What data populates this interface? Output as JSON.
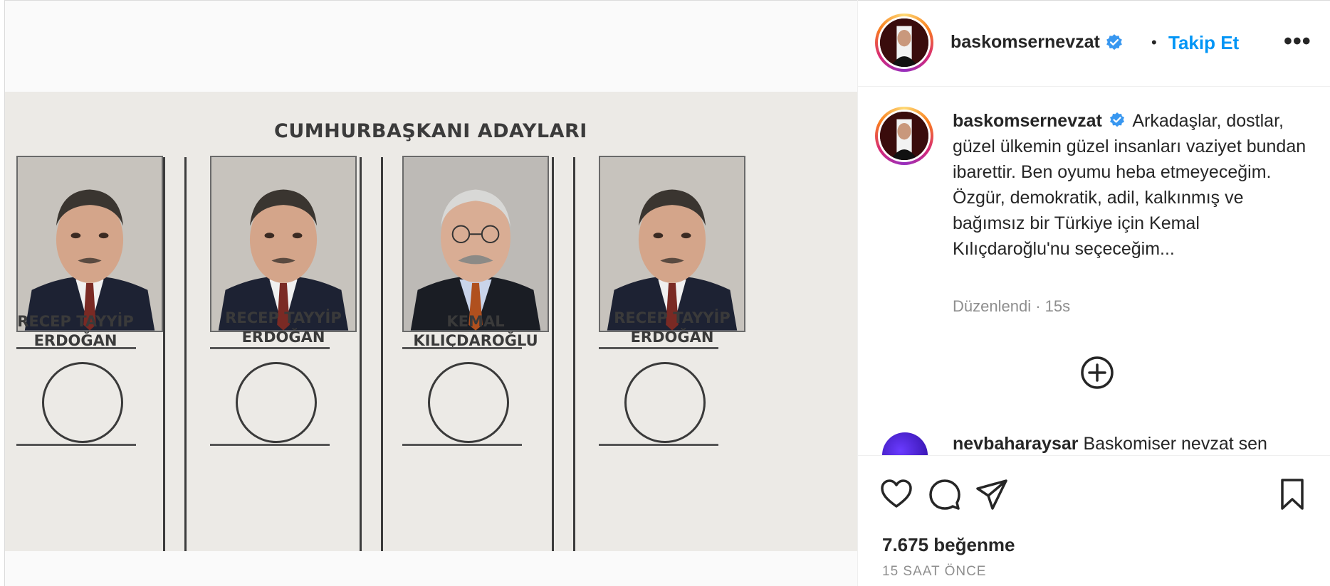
{
  "post": {
    "ballot": {
      "title": "CUMHURBAŞKANI ADAYLARI",
      "candidates": [
        {
          "line1": "RECEP TAYYİP",
          "line2": "ERDOĞAN"
        },
        {
          "line1": "RECEP TAYYİP",
          "line2": "ERDOĞAN"
        },
        {
          "line1": "KEMAL",
          "line2": "KILIÇDAROĞLU"
        },
        {
          "line1": "RECEP TAYYİP",
          "line2": "ERDOĞAN"
        }
      ]
    }
  },
  "header": {
    "username": "baskomsernevzat",
    "separator": "•",
    "follow_label": "Takip Et",
    "more_label": "•••"
  },
  "caption": {
    "username": "baskomsernevzat",
    "text": "Arkadaşlar, dostlar, güzel ülkemin güzel insanları vaziyet bundan ibarettir. Ben oyumu heba etmeyeceğim. Özgür, demokratik, adil, kalkınmış ve bağımsız bir Türkiye için Kemal Kılıçdaroğlu'nu seçeceğim...",
    "meta": "Düzenlendi · 15s"
  },
  "comment_preview": {
    "username": "nevbaharaysar",
    "text": "Baskomiser nevzat sen"
  },
  "footer": {
    "likes": "7.675 beğenme",
    "time": "15 SAAT ÖNCE"
  },
  "icons": [
    "heart-icon",
    "comment-icon",
    "share-icon",
    "bookmark-icon",
    "add-comment-icon",
    "verified-icon",
    "more-icon"
  ],
  "colors": {
    "accent": "#0095f6",
    "verified": "#3897f0",
    "muted": "#8e8e8e",
    "text": "#262626"
  }
}
